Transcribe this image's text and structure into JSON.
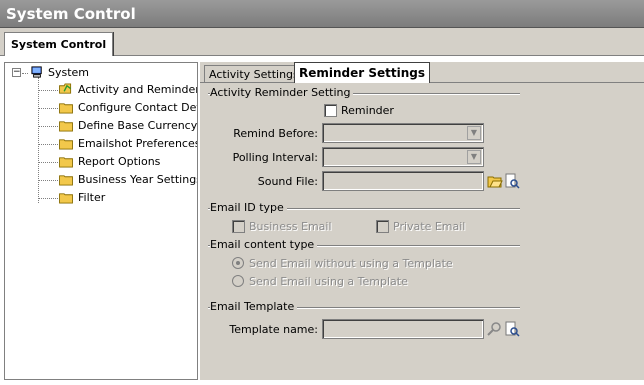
{
  "window": {
    "title": "System Control"
  },
  "outer_tabs": [
    {
      "label": "System Control"
    }
  ],
  "tree": {
    "root": "System",
    "items": [
      "Activity and Reminder Se",
      "Configure Contact Detail",
      "Define Base Currency",
      "Emailshot Preferences",
      "Report Options",
      "Business Year Settings",
      "Filter"
    ]
  },
  "tabs": [
    {
      "label": "Activity Settings"
    },
    {
      "label": "Reminder Settings"
    }
  ],
  "reminder": {
    "group_title": "Activity Reminder Setting",
    "reminder_check_label": "Reminder",
    "reminder_checked": false,
    "remind_before_label": "Remind Before:",
    "remind_before_value": "",
    "polling_interval_label": "Polling Interval:",
    "polling_interval_value": "",
    "sound_file_label": "Sound File:",
    "sound_file_value": ""
  },
  "email_id": {
    "group_title": "Email ID type",
    "business_label": "Business Email",
    "private_label": "Private Email"
  },
  "email_content": {
    "group_title": "Email content type",
    "option_without": "Send Email without using a Template",
    "option_with": "Send Email using a Template",
    "selected": "without"
  },
  "email_template": {
    "group_title": "Email Template",
    "template_name_label": "Template name:",
    "template_name_value": ""
  },
  "colors": {
    "titlebar": "#8a8a8a",
    "panel_bg": "#d4d0c8",
    "folder": "#f2c84b"
  }
}
